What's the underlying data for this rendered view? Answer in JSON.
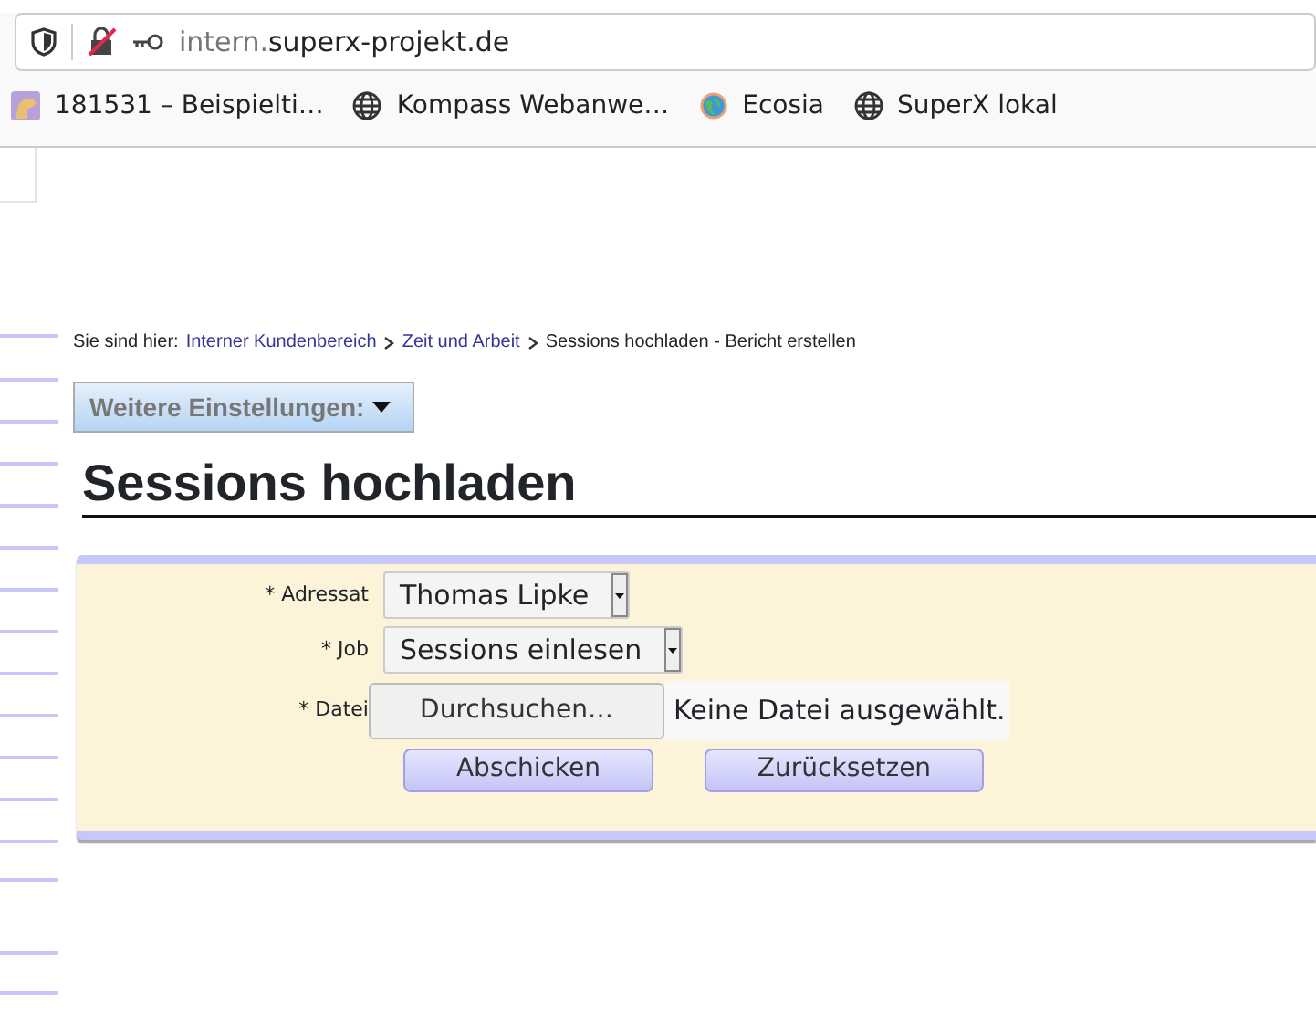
{
  "browser": {
    "url_subdomain": "intern.",
    "url_domain": "superx-projekt.de",
    "bookmarks": [
      {
        "label": "181531 – Beispielti…",
        "kind": "bug"
      },
      {
        "label": "Kompass Webanwe…",
        "kind": "globe"
      },
      {
        "label": "Ecosia",
        "kind": "ecosia"
      },
      {
        "label": "SuperX lokal",
        "kind": "globe"
      }
    ]
  },
  "breadcrumb": {
    "prefix": "Sie sind hier:",
    "links": [
      "Interner Kundenbereich",
      "Zeit und Arbeit"
    ],
    "current": "Sessions hochladen - Bericht erstellen"
  },
  "settings_button": "Weitere Einstellungen:",
  "heading": "Sessions hochladen",
  "form": {
    "fields": [
      {
        "label": "* Adressat",
        "kind": "select",
        "value": "Thomas Lipke"
      },
      {
        "label": "* Job",
        "kind": "select",
        "value": "Sessions einlesen"
      },
      {
        "label": "* Datei",
        "kind": "file",
        "button": "Durchsuchen…",
        "value": "Keine Datei ausgewählt."
      }
    ],
    "buttons": [
      "Abschicken",
      "Zurücksetzen"
    ]
  }
}
